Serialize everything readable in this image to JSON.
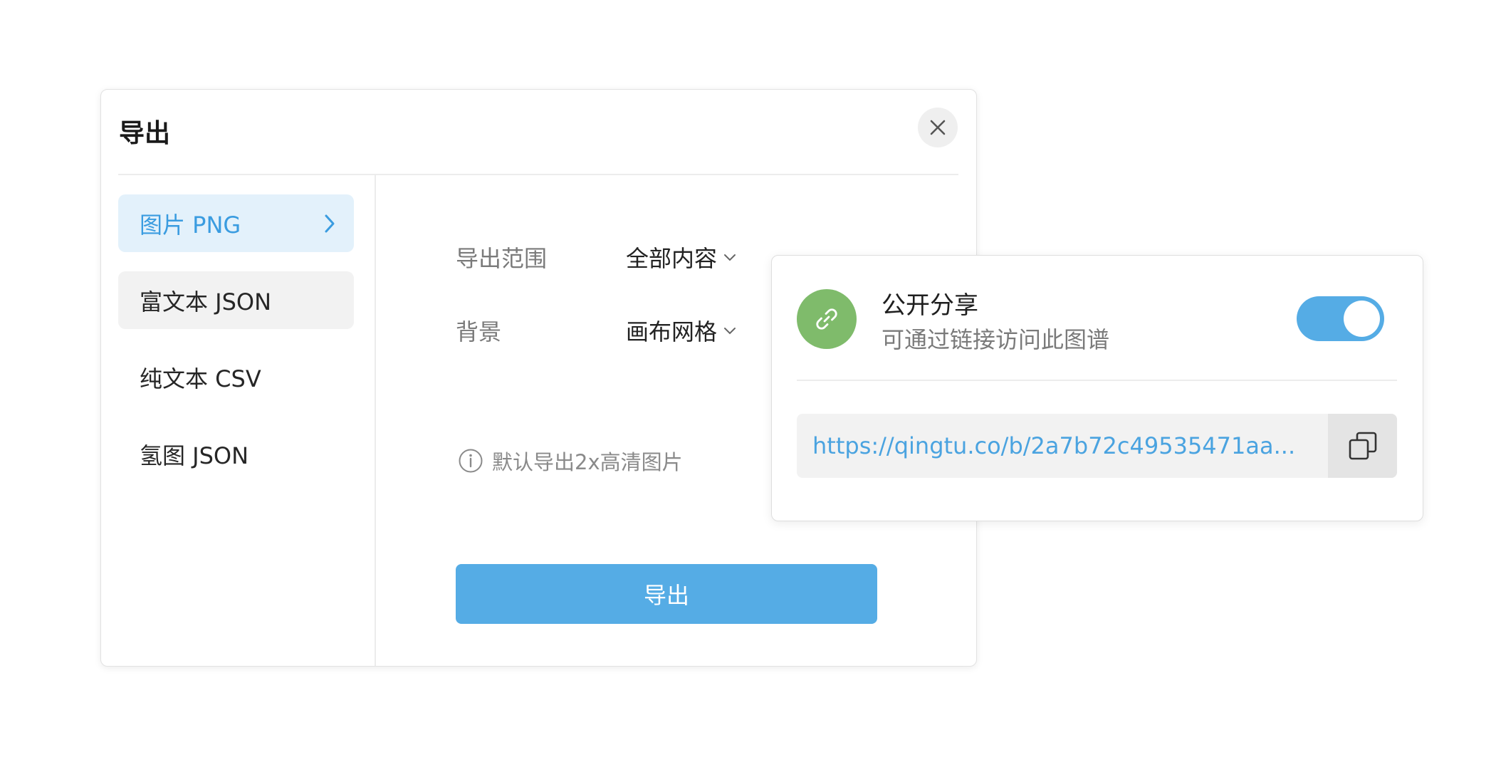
{
  "export_dialog": {
    "title": "导出",
    "formats": [
      {
        "label": "图片 PNG",
        "state": "active"
      },
      {
        "label": "富文本 JSON",
        "state": "hover"
      },
      {
        "label": "纯文本 CSV",
        "state": "normal"
      },
      {
        "label": "氢图 JSON",
        "state": "normal"
      }
    ],
    "range_label": "导出范围",
    "range_value": "全部内容",
    "background_label": "背景",
    "background_value": "画布网格",
    "hint": "默认导出2x高清图片",
    "export_button": "导出"
  },
  "share_panel": {
    "title": "公开分享",
    "description": "可通过链接访问此图谱",
    "toggle_on": true,
    "link": "https://qingtu.co/b/2a7b72c49535471aa..."
  },
  "colors": {
    "accent": "#55ace5",
    "active_bg": "#e3f1fb",
    "link": "#4aa3e0",
    "share_icon_bg": "#7fbb6b"
  },
  "icons": [
    "close-icon",
    "chevron-right-icon",
    "chevron-down-icon",
    "info-icon",
    "link-icon",
    "copy-icon"
  ]
}
